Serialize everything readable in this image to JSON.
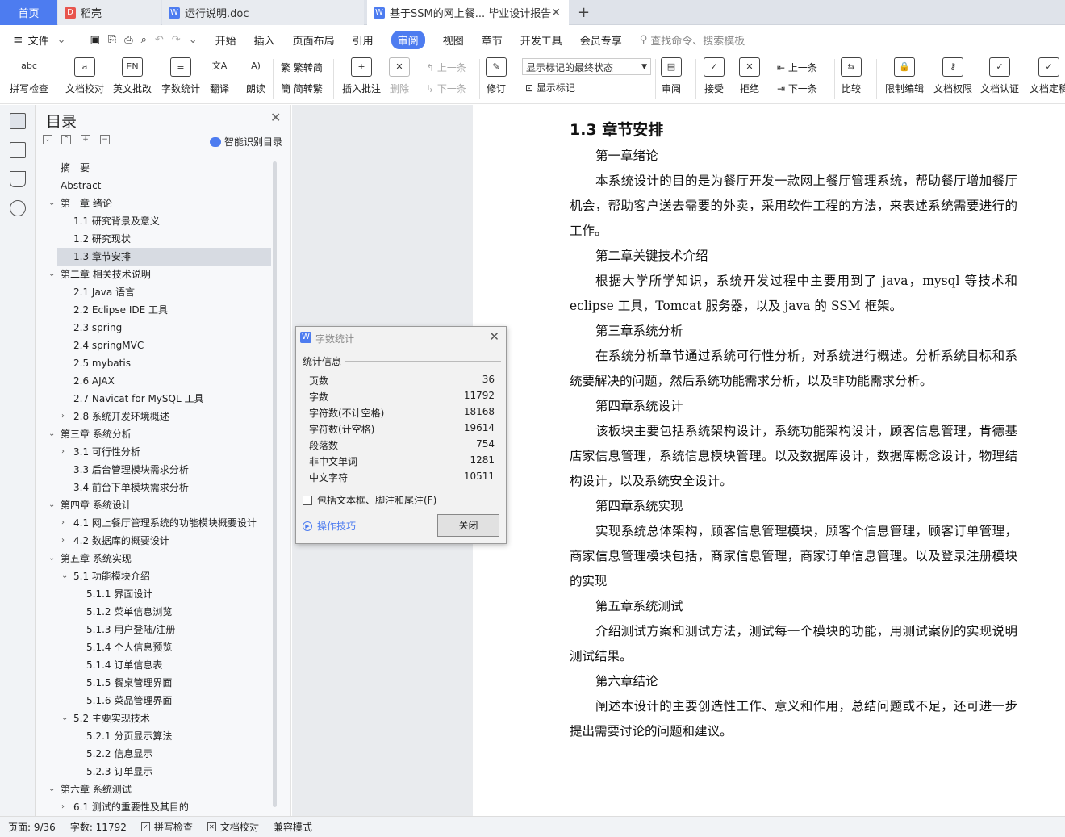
{
  "tabs": [
    {
      "label": "首页"
    },
    {
      "label": "稻壳"
    },
    {
      "label": "运行说明.doc"
    },
    {
      "label": "基于SSM的网上餐... 毕业设计报告"
    }
  ],
  "menu": {
    "file": "文件",
    "items": [
      "开始",
      "插入",
      "页面布局",
      "引用",
      "审阅",
      "视图",
      "章节",
      "开发工具",
      "会员专享"
    ],
    "active": "审阅",
    "search": "查找命令、搜索模板"
  },
  "toolbar": {
    "spell": "拼写检查",
    "proof": "文档校对",
    "engreview": "英文批改",
    "wordcount": "字数统计",
    "translate": "翻译",
    "read": "朗读",
    "trad": "繁转简",
    "simp": "简转繁",
    "addcomment": "插入批注",
    "delete": "删除",
    "prev_comment": "上一条",
    "next_comment": "下一条",
    "revise": "修订",
    "markup_state": "显示标记的最终状态",
    "show_markup": "显示标记",
    "review": "审阅",
    "accept": "接受",
    "reject": "拒绝",
    "prev": "上一条",
    "next": "下一条",
    "compare": "比较",
    "restrict": "限制编辑",
    "perm": "文档权限",
    "cert": "文档认证",
    "finalize": "文档定稿"
  },
  "toc": {
    "title": "目录",
    "smart": "智能识别目录",
    "items": [
      {
        "label": "摘　要"
      },
      {
        "label": "Abstract"
      },
      {
        "label": "第一章  绪论"
      },
      {
        "label": "1.1 研究背景及意义"
      },
      {
        "label": "1.2 研究现状"
      },
      {
        "label": "1.3 章节安排"
      },
      {
        "label": "第二章  相关技术说明"
      },
      {
        "label": "2.1 Java 语言"
      },
      {
        "label": "2.2 Eclipse IDE 工具"
      },
      {
        "label": "2.3 spring"
      },
      {
        "label": "2.4 springMVC"
      },
      {
        "label": "2.5 mybatis"
      },
      {
        "label": "2.6 AJAX"
      },
      {
        "label": "2.7 Navicat for MySQL 工具"
      },
      {
        "label": "2.8 系统开发环境概述"
      },
      {
        "label": "第三章  系统分析"
      },
      {
        "label": "3.1 可行性分析"
      },
      {
        "label": "3.3 后台管理模块需求分析"
      },
      {
        "label": "3.4 前台下单模块需求分析"
      },
      {
        "label": "第四章  系统设计"
      },
      {
        "label": "4.1 网上餐厅管理系统的功能模块概要设计"
      },
      {
        "label": "4.2 数据库的概要设计"
      },
      {
        "label": "第五章  系统实现"
      },
      {
        "label": "5.1 功能模块介绍"
      },
      {
        "label": "5.1.1 界面设计"
      },
      {
        "label": "5.1.2  菜单信息浏览"
      },
      {
        "label": "5.1.3  用户登陆/注册"
      },
      {
        "label": "5.1.4  个人信息预览"
      },
      {
        "label": "5.1.4  订单信息表"
      },
      {
        "label": "5.1.5  餐桌管理界面"
      },
      {
        "label": "5.1.6  菜品管理界面"
      },
      {
        "label": "5.2 主要实现技术"
      },
      {
        "label": "5.2.1 分页显示算法"
      },
      {
        "label": "5.2.2  信息显示"
      },
      {
        "label": "5.2.3  订单显示"
      },
      {
        "label": "第六章  系统测试"
      },
      {
        "label": "6.1 测试的重要性及其目的"
      }
    ]
  },
  "doc": {
    "heading": "1.3 章节安排",
    "paragraphs": [
      "第一章绪论",
      "本系统设计的目的是为餐厅开发一款网上餐厅管理系统，帮助餐厅增加餐厅机会，帮助客户送去需要的外卖，采用软件工程的方法，来表述系统需要进行的工作。",
      "第二章关键技术介绍",
      "根据大学所学知识，系统开发过程中主要用到了 java，mysql 等技术和 eclipse 工具，Tomcat 服务器，以及 java 的 SSM 框架。",
      "第三章系统分析",
      "在系统分析章节通过系统可行性分析，对系统进行概述。分析系统目标和系统要解决的问题，然后系统功能需求分析，以及非功能需求分析。",
      "第四章系统设计",
      "该板块主要包括系统架构设计，系统功能架构设计，顾客信息管理，肯德基店家信息管理，系统信息模块管理。以及数据库设计，数据库概念设计，物理结构设计，以及系统安全设计。",
      "第四章系统实现",
      "实现系统总体架构，顾客信息管理模块，顾客个信息管理，顾客订单管理，商家信息管理模块包括，商家信息管理，商家订单信息管理。以及登录注册模块的实现",
      "第五章系统测试",
      "介绍测试方案和测试方法，测试每一个模块的功能，用测试案例的实现说明测试结果。",
      "第六章结论",
      "阐述本设计的主要创造性工作、意义和作用，总结问题或不足，还可进一步提出需要讨论的问题和建议。"
    ]
  },
  "dialog": {
    "title": "字数统计",
    "section": "统计信息",
    "rows": [
      {
        "label": "页数",
        "value": "36"
      },
      {
        "label": "字数",
        "value": "11792"
      },
      {
        "label": "字符数(不计空格)",
        "value": "18168"
      },
      {
        "label": "字符数(计空格)",
        "value": "19614"
      },
      {
        "label": "段落数",
        "value": "754"
      },
      {
        "label": "非中文单词",
        "value": "1281"
      },
      {
        "label": "中文字符",
        "value": "10511"
      }
    ],
    "checkbox": "包括文本框、脚注和尾注(F)",
    "tip": "操作技巧",
    "close": "关闭"
  },
  "status": {
    "page": "页面: 9/36",
    "words": "字数: 11792",
    "spell": "拼写检查",
    "proof": "文档校对",
    "mode": "兼容模式"
  }
}
